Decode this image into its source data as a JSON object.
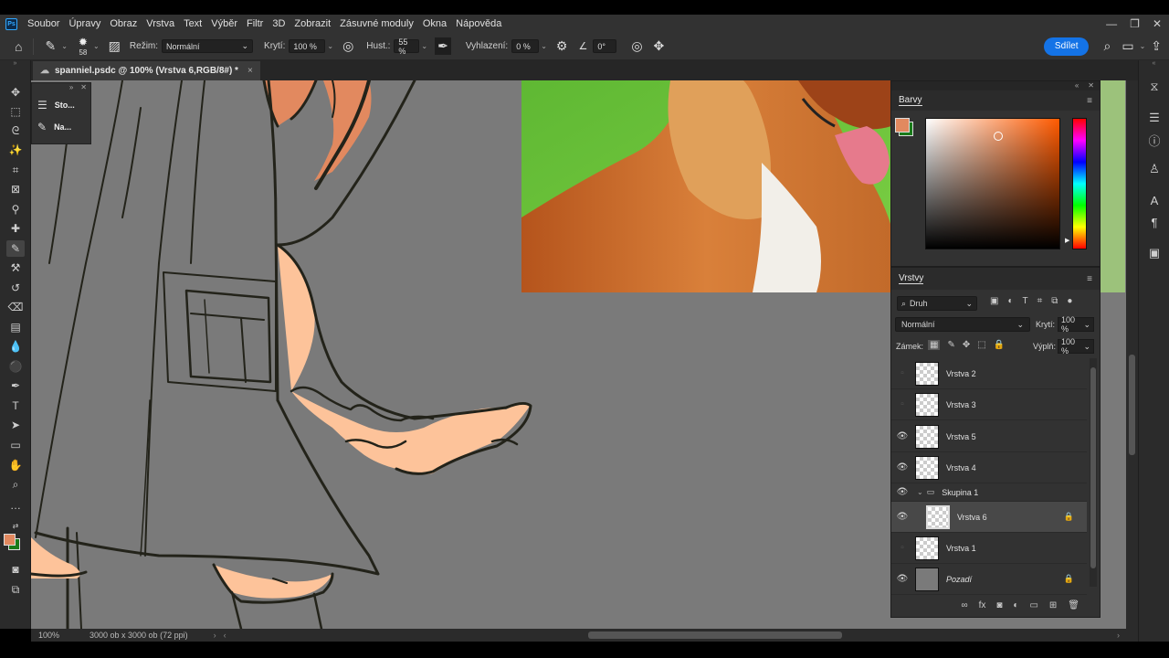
{
  "menu": [
    "Soubor",
    "Úpravy",
    "Obraz",
    "Vrstva",
    "Text",
    "Výběr",
    "Filtr",
    "3D",
    "Zobrazit",
    "Zásuvné moduly",
    "Okna",
    "Nápověda"
  ],
  "logo": "Ps",
  "window_controls": [
    "—",
    "❐",
    "✕"
  ],
  "options": {
    "brush_size": "58",
    "mode_label": "Režim:",
    "mode_value": "Normální",
    "opacity_label": "Krytí:",
    "opacity_value": "100 %",
    "flow_label": "Hust.:",
    "flow_value": "55 %",
    "smoothing_label": "Vyhlazení:",
    "smoothing_value": "0 %",
    "angle_value": "0°",
    "share": "Sdílet"
  },
  "document_tab": {
    "title": "spanniel.psdc @ 100% (Vrstva 6,RGB/8#) *",
    "close": "×"
  },
  "float_panel": {
    "items": [
      "Sto...",
      "Na..."
    ]
  },
  "colors_panel": {
    "title": "Barvy",
    "fg_color": "#e2895f",
    "bg_color": "#1a7a1a"
  },
  "layers_panel": {
    "title": "Vrstvy",
    "filter_kind": "Druh",
    "blend_mode": "Normální",
    "opacity_label": "Krytí:",
    "opacity_value": "100 %",
    "lock_label": "Zámek:",
    "fill_label": "Výplň:",
    "fill_value": "100 %",
    "layers": [
      {
        "name": "Vrstva 2",
        "visible": false
      },
      {
        "name": "Vrstva 3",
        "visible": false
      },
      {
        "name": "Vrstva 5",
        "visible": true
      },
      {
        "name": "Vrstva 4",
        "visible": true
      },
      {
        "name": "Skupina 1",
        "visible": true,
        "group": true
      },
      {
        "name": "Vrstva 6",
        "visible": true,
        "selected": true,
        "locked": true
      },
      {
        "name": "Vrstva 1",
        "visible": false
      },
      {
        "name": "Pozadí",
        "visible": true,
        "locked": true
      }
    ]
  },
  "status": {
    "zoom": "100%",
    "doc_size": "3000 ob x 3000 ob (72 ppi)"
  },
  "palette": {
    "accent": "#1473e6",
    "skin": "#fdc39a",
    "hair": "#e2895f",
    "line": "#23231a"
  }
}
